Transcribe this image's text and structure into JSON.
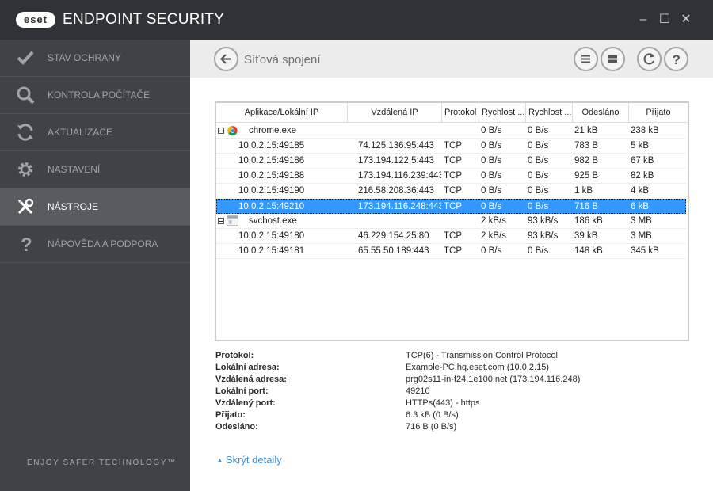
{
  "app": {
    "logo_text": "eset",
    "title": "ENDPOINT SECURITY",
    "minimize": "–",
    "maximize": "☐",
    "close": "✕"
  },
  "sidebar": {
    "items": [
      {
        "label": "STAV OCHRANY",
        "icon": "checkmark-icon"
      },
      {
        "label": "KONTROLA POČÍTAČE",
        "icon": "search-icon"
      },
      {
        "label": "AKTUALIZACE",
        "icon": "refresh-icon"
      },
      {
        "label": "NASTAVENÍ",
        "icon": "gear-icon"
      },
      {
        "label": "NÁSTROJE",
        "icon": "tools-icon",
        "active": true
      },
      {
        "label": "NÁPOVĚDA A PODPORA",
        "icon": "question-icon"
      }
    ],
    "tagline": "ENJOY SAFER TECHNOLOGY™"
  },
  "header": {
    "title": "Síťová spojení",
    "back_icon": "back-arrow-icon",
    "buttons": [
      "list-menu-icon",
      "collapse-icon",
      "refresh-icon",
      "help-icon"
    ]
  },
  "table": {
    "columns": [
      "Aplikace/Lokální IP",
      "Vzdálená IP",
      "Protokol",
      "Rychlost ...",
      "Rychlost ...",
      "Odesláno",
      "Přijato"
    ],
    "rows": [
      {
        "type": "app",
        "icon": "chrome-icon",
        "name": "chrome.exe",
        "remote": "",
        "proto": "",
        "s1": "0 B/s",
        "s2": "0 B/s",
        "sent": "21 kB",
        "recv": "238 kB"
      },
      {
        "type": "conn",
        "name": "10.0.2.15:49185",
        "remote": "74.125.136.95:443",
        "proto": "TCP",
        "s1": "0 B/s",
        "s2": "0 B/s",
        "sent": "783 B",
        "recv": "5 kB"
      },
      {
        "type": "conn",
        "name": "10.0.2.15:49186",
        "remote": "173.194.122.5:443",
        "proto": "TCP",
        "s1": "0 B/s",
        "s2": "0 B/s",
        "sent": "982 B",
        "recv": "67 kB"
      },
      {
        "type": "conn",
        "name": "10.0.2.15:49188",
        "remote": "173.194.116.239:443",
        "proto": "TCP",
        "s1": "0 B/s",
        "s2": "0 B/s",
        "sent": "925 B",
        "recv": "82 kB"
      },
      {
        "type": "conn",
        "name": "10.0.2.15:49190",
        "remote": "216.58.208.36:443",
        "proto": "TCP",
        "s1": "0 B/s",
        "s2": "0 B/s",
        "sent": "1 kB",
        "recv": "4 kB"
      },
      {
        "type": "conn",
        "selected": true,
        "name": "10.0.2.15:49210",
        "remote": "173.194.116.248:443",
        "proto": "TCP",
        "s1": "0 B/s",
        "s2": "0 B/s",
        "sent": "716 B",
        "recv": "6 kB"
      },
      {
        "type": "app",
        "icon": "window-app-icon",
        "name": "svchost.exe",
        "remote": "",
        "proto": "",
        "s1": "2 kB/s",
        "s2": "93 kB/s",
        "sent": "186 kB",
        "recv": "3 MB"
      },
      {
        "type": "conn",
        "name": "10.0.2.15:49180",
        "remote": "46.229.154.25:80",
        "proto": "TCP",
        "s1": "2 kB/s",
        "s2": "93 kB/s",
        "sent": "39 kB",
        "recv": "3 MB"
      },
      {
        "type": "conn",
        "name": "10.0.2.15:49181",
        "remote": "65.55.50.189:443",
        "proto": "TCP",
        "s1": "0 B/s",
        "s2": "0 B/s",
        "sent": "148 kB",
        "recv": "345 kB"
      }
    ]
  },
  "details": [
    {
      "label": "Protokol:",
      "value": "TCP(6) - Transmission Control Protocol"
    },
    {
      "label": "Lokální adresa:",
      "value": "Example-PC.hq.eset.com (10.0.2.15)"
    },
    {
      "label": "Vzdálená adresa:",
      "value": "prg02s11-in-f24.1e100.net (173.194.116.248)"
    },
    {
      "label": "Lokální port:",
      "value": "49210"
    },
    {
      "label": "Vzdálený port:",
      "value": "HTTPs(443) - https"
    },
    {
      "label": "Přijato:",
      "value": "6.3 kB (0 B/s)"
    },
    {
      "label": "Odesláno:",
      "value": "716 B (0 B/s)"
    }
  ],
  "hide_details": "Skrýt detaily",
  "colors": {
    "accent": "#3d8fd1",
    "selection": "#3399ff",
    "sidebar": "#3f4346",
    "titlebar": "#2f3337"
  }
}
